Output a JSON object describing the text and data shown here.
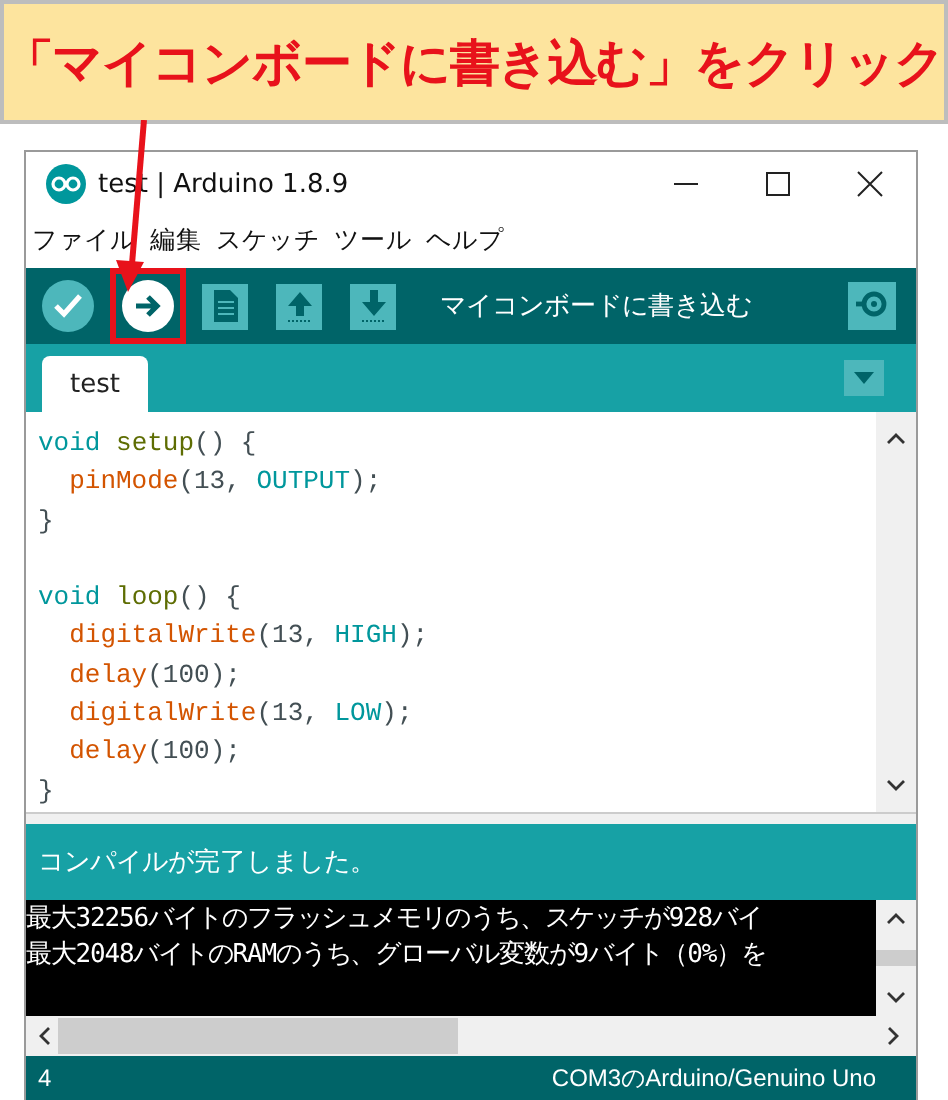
{
  "annotation": {
    "text": "「マイコンボードに書き込む」をクリック"
  },
  "window": {
    "title": "test | Arduino 1.8.9"
  },
  "menu": [
    "ファイル",
    "編集",
    "スケッチ",
    "ツール",
    "ヘルプ"
  ],
  "toolbar": {
    "buttons": [
      {
        "kind": "verify",
        "selected": false,
        "highlighted": false
      },
      {
        "kind": "upload",
        "selected": true,
        "highlighted": true
      },
      {
        "kind": "new",
        "highlighted": false
      },
      {
        "kind": "open",
        "highlighted": false
      },
      {
        "kind": "save",
        "highlighted": false
      }
    ],
    "hint": "マイコンボードに書き込む"
  },
  "tabs": [
    {
      "label": "test",
      "selected": true
    }
  ],
  "code": [
    {
      "indent": false,
      "blank_before": false,
      "tokens": [
        {
          "kind": "type",
          "text": "void "
        },
        {
          "kind": "builtin",
          "text": "setup"
        },
        {
          "kind": "plain",
          "text": "() {"
        }
      ]
    },
    {
      "indent": true,
      "blank_before": false,
      "tokens": [
        {
          "kind": "function",
          "text": "pinMode"
        },
        {
          "kind": "plain",
          "text": "(13, "
        },
        {
          "kind": "constant",
          "text": "OUTPUT"
        },
        {
          "kind": "plain",
          "text": ");"
        }
      ]
    },
    {
      "indent": false,
      "blank_before": false,
      "tokens": [
        {
          "kind": "plain",
          "text": "}"
        }
      ]
    },
    {
      "indent": false,
      "blank_before": true,
      "tokens": [
        {
          "kind": "type",
          "text": "void "
        },
        {
          "kind": "builtin",
          "text": "loop"
        },
        {
          "kind": "plain",
          "text": "() {"
        }
      ]
    },
    {
      "indent": true,
      "blank_before": false,
      "tokens": [
        {
          "kind": "function",
          "text": "digitalWrite"
        },
        {
          "kind": "plain",
          "text": "(13, "
        },
        {
          "kind": "constant",
          "text": "HIGH"
        },
        {
          "kind": "plain",
          "text": ");"
        }
      ]
    },
    {
      "indent": true,
      "blank_before": false,
      "tokens": [
        {
          "kind": "function",
          "text": "delay"
        },
        {
          "kind": "plain",
          "text": "(100);"
        }
      ]
    },
    {
      "indent": true,
      "blank_before": false,
      "tokens": [
        {
          "kind": "function",
          "text": "digitalWrite"
        },
        {
          "kind": "plain",
          "text": "(13, "
        },
        {
          "kind": "constant",
          "text": "LOW"
        },
        {
          "kind": "plain",
          "text": ");"
        }
      ]
    },
    {
      "indent": true,
      "blank_before": false,
      "tokens": [
        {
          "kind": "function",
          "text": "delay"
        },
        {
          "kind": "plain",
          "text": "(100);"
        }
      ]
    },
    {
      "indent": false,
      "blank_before": false,
      "tokens": [
        {
          "kind": "plain",
          "text": "}"
        }
      ]
    }
  ],
  "message": "コンパイルが完了しました。",
  "console": [
    "最大32256バイトのフラッシュメモリのうち、スケッチが928バイ",
    "最大2048バイトのRAMのうち、グローバル変数が9バイト（0%）を"
  ],
  "status_bar": {
    "line": "4",
    "board": "COM3のArduino/Genuino Uno"
  }
}
